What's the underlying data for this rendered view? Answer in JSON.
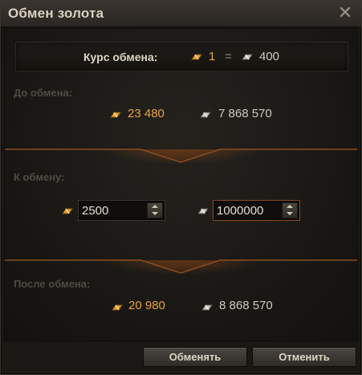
{
  "window": {
    "title": "Обмен золота",
    "close_label": "✕"
  },
  "rate": {
    "label": "Курс обмена:",
    "gold": "1",
    "equals": "=",
    "silver": "400"
  },
  "before": {
    "label": "До обмена:",
    "gold": "23 480",
    "silver": "7 868 570"
  },
  "exchange": {
    "label": "К обмену:",
    "gold_value": "2500",
    "silver_value": "1000000"
  },
  "after": {
    "label": "После обмена:",
    "gold": "20 980",
    "silver": "8 868 570"
  },
  "buttons": {
    "exchange": "Обменять",
    "cancel": "Отменить"
  },
  "colors": {
    "gold": "#e9a43a",
    "silver": "#cfcac0",
    "accent": "#a55a23"
  },
  "icons": {
    "gold": "gold-bar-icon",
    "silver": "silver-coin-icon",
    "close": "close-icon"
  }
}
